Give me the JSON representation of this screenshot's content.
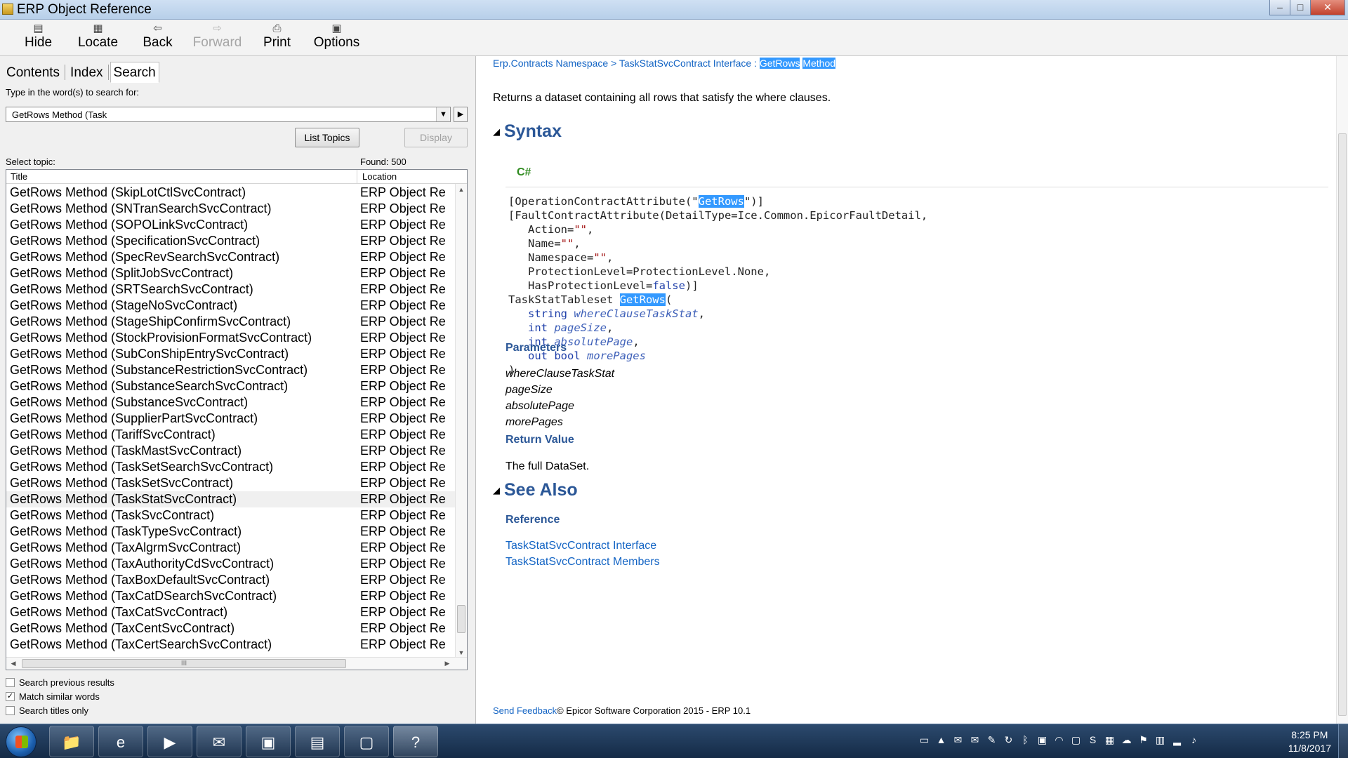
{
  "window": {
    "title": "ERP Object Reference",
    "minimize": "–",
    "maximize": "□",
    "close": "✕"
  },
  "toolbar": {
    "hide": "Hide",
    "locate": "Locate",
    "back": "Back",
    "forward": "Forward",
    "print": "Print",
    "options": "Options"
  },
  "left": {
    "tabs": {
      "contents": "Contents",
      "index": "Index",
      "search": "Search"
    },
    "search_prompt": "Type in the word(s) to search for:",
    "search_value": "GetRows Method (Task",
    "list_topics": "List Topics",
    "display": "Display",
    "select_topic": "Select topic:",
    "found": "Found: 500",
    "col_title": "Title",
    "col_location": "Location",
    "location_text": "ERP Object Re",
    "rows": [
      "GetRows Method (SkipLotCtlSvcContract)",
      "GetRows Method (SNTranSearchSvcContract)",
      "GetRows Method (SOPOLinkSvcContract)",
      "GetRows Method (SpecificationSvcContract)",
      "GetRows Method (SpecRevSearchSvcContract)",
      "GetRows Method (SplitJobSvcContract)",
      "GetRows Method (SRTSearchSvcContract)",
      "GetRows Method (StageNoSvcContract)",
      "GetRows Method (StageShipConfirmSvcContract)",
      "GetRows Method (StockProvisionFormatSvcContract)",
      "GetRows Method (SubConShipEntrySvcContract)",
      "GetRows Method (SubstanceRestrictionSvcContract)",
      "GetRows Method (SubstanceSearchSvcContract)",
      "GetRows Method (SubstanceSvcContract)",
      "GetRows Method (SupplierPartSvcContract)",
      "GetRows Method (TariffSvcContract)",
      "GetRows Method (TaskMastSvcContract)",
      "GetRows Method (TaskSetSearchSvcContract)",
      "GetRows Method (TaskSetSvcContract)",
      "GetRows Method (TaskStatSvcContract)",
      "GetRows Method (TaskSvcContract)",
      "GetRows Method (TaskTypeSvcContract)",
      "GetRows Method (TaxAlgrmSvcContract)",
      "GetRows Method (TaxAuthorityCdSvcContract)",
      "GetRows Method (TaxBoxDefaultSvcContract)",
      "GetRows Method (TaxCatDSearchSvcContract)",
      "GetRows Method (TaxCatSvcContract)",
      "GetRows Method (TaxCentSvcContract)",
      "GetRows Method (TaxCertSearchSvcContract)"
    ],
    "selected_index": 19,
    "checks": {
      "prev": "Search previous results",
      "similar": "Match similar words",
      "titles": "Search titles only"
    },
    "scroll_grip": "III"
  },
  "right": {
    "breadcrumb": {
      "ns": "Erp.Contracts Namespace",
      "sep": " > ",
      "iface": "TaskStatSvcContract Interface",
      "colon": " : ",
      "getrows": "GetRows",
      "method": "Method"
    },
    "description": "Returns a dataset containing all rows that satisfy the where clauses.",
    "syntax_heading": "Syntax",
    "lang": "C#",
    "code": {
      "l1a": "[OperationContractAttribute(\"",
      "l1b": "GetRows",
      "l1c": "\")]",
      "l2": "[FaultContractAttribute(DetailType=Ice.Common.EpicorFaultDetail,",
      "l3a": "   Action=",
      "l3b": "\"\"",
      "l3c": ",",
      "l4a": "   Name=",
      "l4b": "\"\"",
      "l4c": ",",
      "l5a": "   Namespace=",
      "l5b": "\"\"",
      "l5c": ",",
      "l6": "   ProtectionLevel=ProtectionLevel.None,",
      "l7a": "   HasProtectionLevel=",
      "l7b": "false",
      "l7c": ")]",
      "l8a": "TaskStatTableset ",
      "l8b": "GetRows",
      "l8c": "(",
      "l9a": "   string ",
      "l9b": "whereClauseTaskStat",
      "l9c": ",",
      "l10a": "   int ",
      "l10b": "pageSize",
      "l10c": ",",
      "l11a": "   int ",
      "l11b": "absolutePage",
      "l11c": ",",
      "l12a": "   out bool ",
      "l12b": "morePages",
      "l13": ")"
    },
    "parameters_heading": "Parameters",
    "params": [
      "whereClauseTaskStat",
      "pageSize",
      "absolutePage",
      "morePages"
    ],
    "return_heading": "Return Value",
    "return_text": "The full DataSet.",
    "see_also_heading": "See Also",
    "reference_heading": "Reference",
    "links": [
      "TaskStatSvcContract Interface",
      "TaskStatSvcContract Members"
    ],
    "footer_feedback": "Send Feedback",
    "footer_copy": "© Epicor Software Corporation 2015 - ERP 10.1"
  },
  "taskbar": {
    "time": "8:25 PM",
    "date": "11/8/2017",
    "apps": [
      "folder-icon",
      "ie-icon",
      "media-player-icon",
      "outlook-icon",
      "remote-desktop-icon",
      "card-app-icon",
      "computer-icon",
      "help-icon"
    ]
  }
}
